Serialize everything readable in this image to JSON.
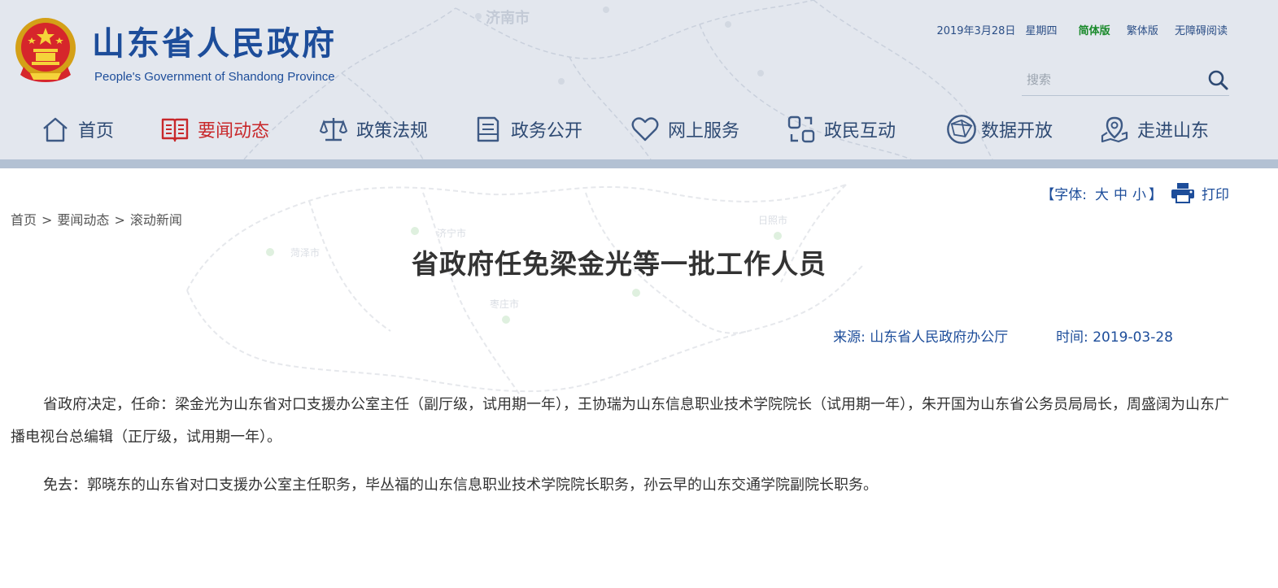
{
  "header": {
    "title": "山东省人民政府",
    "subtitle": "People's Government of Shandong Province",
    "date": "2019年3月28日",
    "weekday": "星期四",
    "lang_simplified": "简体版",
    "lang_traditional": "繁体版",
    "accessibility": "无障碍阅读",
    "map_label": "济南市"
  },
  "search": {
    "placeholder": "搜索",
    "value": ""
  },
  "nav": {
    "items": [
      {
        "label": "首页",
        "icon": "home-icon"
      },
      {
        "label": "要闻动态",
        "icon": "book-icon",
        "active": true
      },
      {
        "label": "政策法规",
        "icon": "scale-icon"
      },
      {
        "label": "政务公开",
        "icon": "document-icon"
      },
      {
        "label": "网上服务",
        "icon": "heart-icon"
      },
      {
        "label": "政民互动",
        "icon": "interaction-icon"
      },
      {
        "label": "数据开放",
        "icon": "globe-icon"
      },
      {
        "label": "走进山东",
        "icon": "map-pin-icon"
      }
    ]
  },
  "breadcrumb": [
    "首页",
    "要闻动态",
    "滚动新闻"
  ],
  "breadcrumb_sep": ">",
  "tools": {
    "font_prefix": "【字体:",
    "font_large": "大",
    "font_medium": "中",
    "font_small": "小",
    "font_suffix": "】",
    "print_label": "打印"
  },
  "body_map_labels": [
    "济宁市",
    "菏泽市",
    "枣庄市",
    "日照市"
  ],
  "article": {
    "title": "省政府任免梁金光等一批工作人员",
    "source_label": "来源:",
    "source": "山东省人民政府办公厅",
    "time_label": "时间:",
    "time": "2019-03-28",
    "paragraphs": [
      "省政府决定，任命：梁金光为山东省对口支援办公室主任（副厅级，试用期一年），王协瑞为山东信息职业技术学院院长（试用期一年），朱开国为山东省公务员局局长，周盛阔为山东广播电视台总编辑（正厅级，试用期一年）。",
      "免去：郭晓东的山东省对口支援办公室主任职务，毕丛福的山东信息职业技术学院院长职务，孙云早的山东交通学院副院长职务。"
    ]
  },
  "colors": {
    "brand_blue": "#1d4d9a",
    "nav_text": "#2e4a73",
    "nav_active": "#c8282b",
    "lang_active": "#1a8a2b",
    "header_bg": "#e3e7ee",
    "header_bar": "#b3c1d3"
  }
}
